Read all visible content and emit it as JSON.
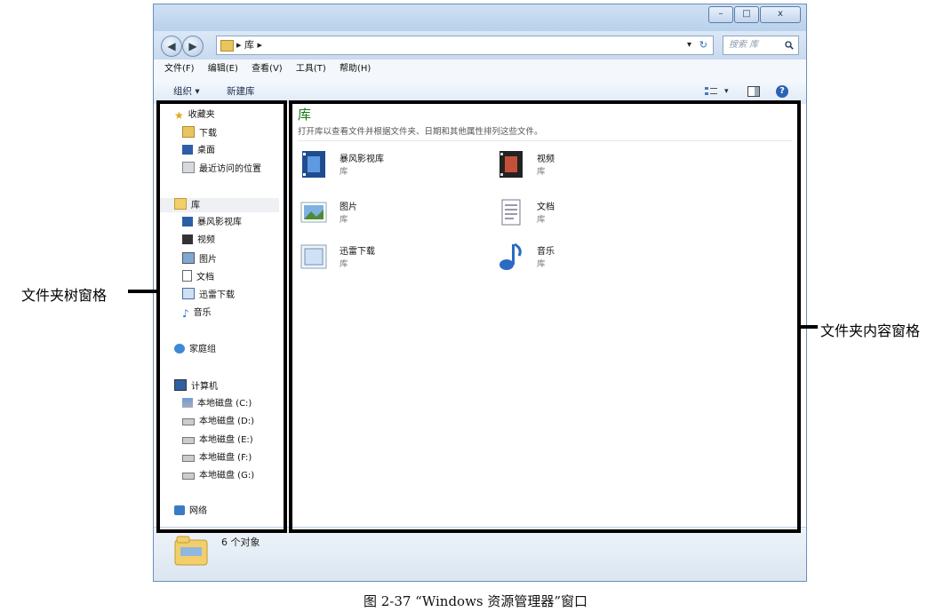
{
  "window": {
    "minimize": "–",
    "maximize": "□",
    "close": "x"
  },
  "nav": {
    "back": "◀",
    "forward": "▶",
    "address_path": "▸ 库 ▸",
    "refresh": "↻",
    "dropdown": "▾",
    "search_placeholder": "搜索 库",
    "search_icon": "magnifier-icon"
  },
  "menu": [
    "文件(F)",
    "编辑(E)",
    "查看(V)",
    "工具(T)",
    "帮助(H)"
  ],
  "toolbar": {
    "organize": "组织 ▾",
    "new_library": "新建库",
    "view_icon": "view-options-icon",
    "view_dropdown": "▾",
    "preview_icon": "preview-pane-icon",
    "help": "?"
  },
  "tree": {
    "favorites": {
      "label": "收藏夹",
      "icon": "star-icon"
    },
    "favorites_items": [
      {
        "label": "下载",
        "icon": "downloads-icon"
      },
      {
        "label": "桌面",
        "icon": "desktop-icon"
      },
      {
        "label": "最近访问的位置",
        "icon": "recent-places-icon"
      }
    ],
    "libraries": {
      "label": "库",
      "icon": "libraries-icon"
    },
    "library_items": [
      {
        "label": "暴风影视库",
        "icon": "video-library-icon"
      },
      {
        "label": "视频",
        "icon": "video-icon"
      },
      {
        "label": "图片",
        "icon": "picture-icon"
      },
      {
        "label": "文档",
        "icon": "document-icon"
      },
      {
        "label": "迅雷下载",
        "icon": "download-folder-icon"
      },
      {
        "label": "音乐",
        "icon": "music-icon"
      }
    ],
    "homegroup": {
      "label": "家庭组",
      "icon": "homegroup-icon"
    },
    "computer": {
      "label": "计算机",
      "icon": "computer-icon"
    },
    "drives": [
      {
        "label": "本地磁盘 (C:)",
        "icon": "system-drive-icon"
      },
      {
        "label": "本地磁盘 (D:)",
        "icon": "drive-icon"
      },
      {
        "label": "本地磁盘 (E:)",
        "icon": "drive-icon"
      },
      {
        "label": "本地磁盘 (F:)",
        "icon": "drive-icon"
      },
      {
        "label": "本地磁盘 (G:)",
        "icon": "drive-icon"
      }
    ],
    "network": {
      "label": "网络",
      "icon": "network-icon"
    }
  },
  "main": {
    "title": "库",
    "description": "打开库以查看文件并根据文件夹、日期和其他属性排列这些文件。",
    "items": [
      {
        "name": "暴风影视库",
        "sub": "库",
        "icon": "video-library-icon"
      },
      {
        "name": "视频",
        "sub": "库",
        "icon": "video-icon"
      },
      {
        "name": "图片",
        "sub": "库",
        "icon": "picture-icon"
      },
      {
        "name": "文档",
        "sub": "库",
        "icon": "document-icon"
      },
      {
        "name": "迅雷下载",
        "sub": "库",
        "icon": "download-folder-icon"
      },
      {
        "name": "音乐",
        "sub": "库",
        "icon": "music-icon"
      }
    ]
  },
  "status": {
    "text": "6 个对象",
    "icon": "libraries-folder-icon"
  },
  "annotations": {
    "left": "文件夹树窗格",
    "right": "文件夹内容窗格"
  },
  "caption": "图 2-37 “Windows 资源管理器”窗口"
}
